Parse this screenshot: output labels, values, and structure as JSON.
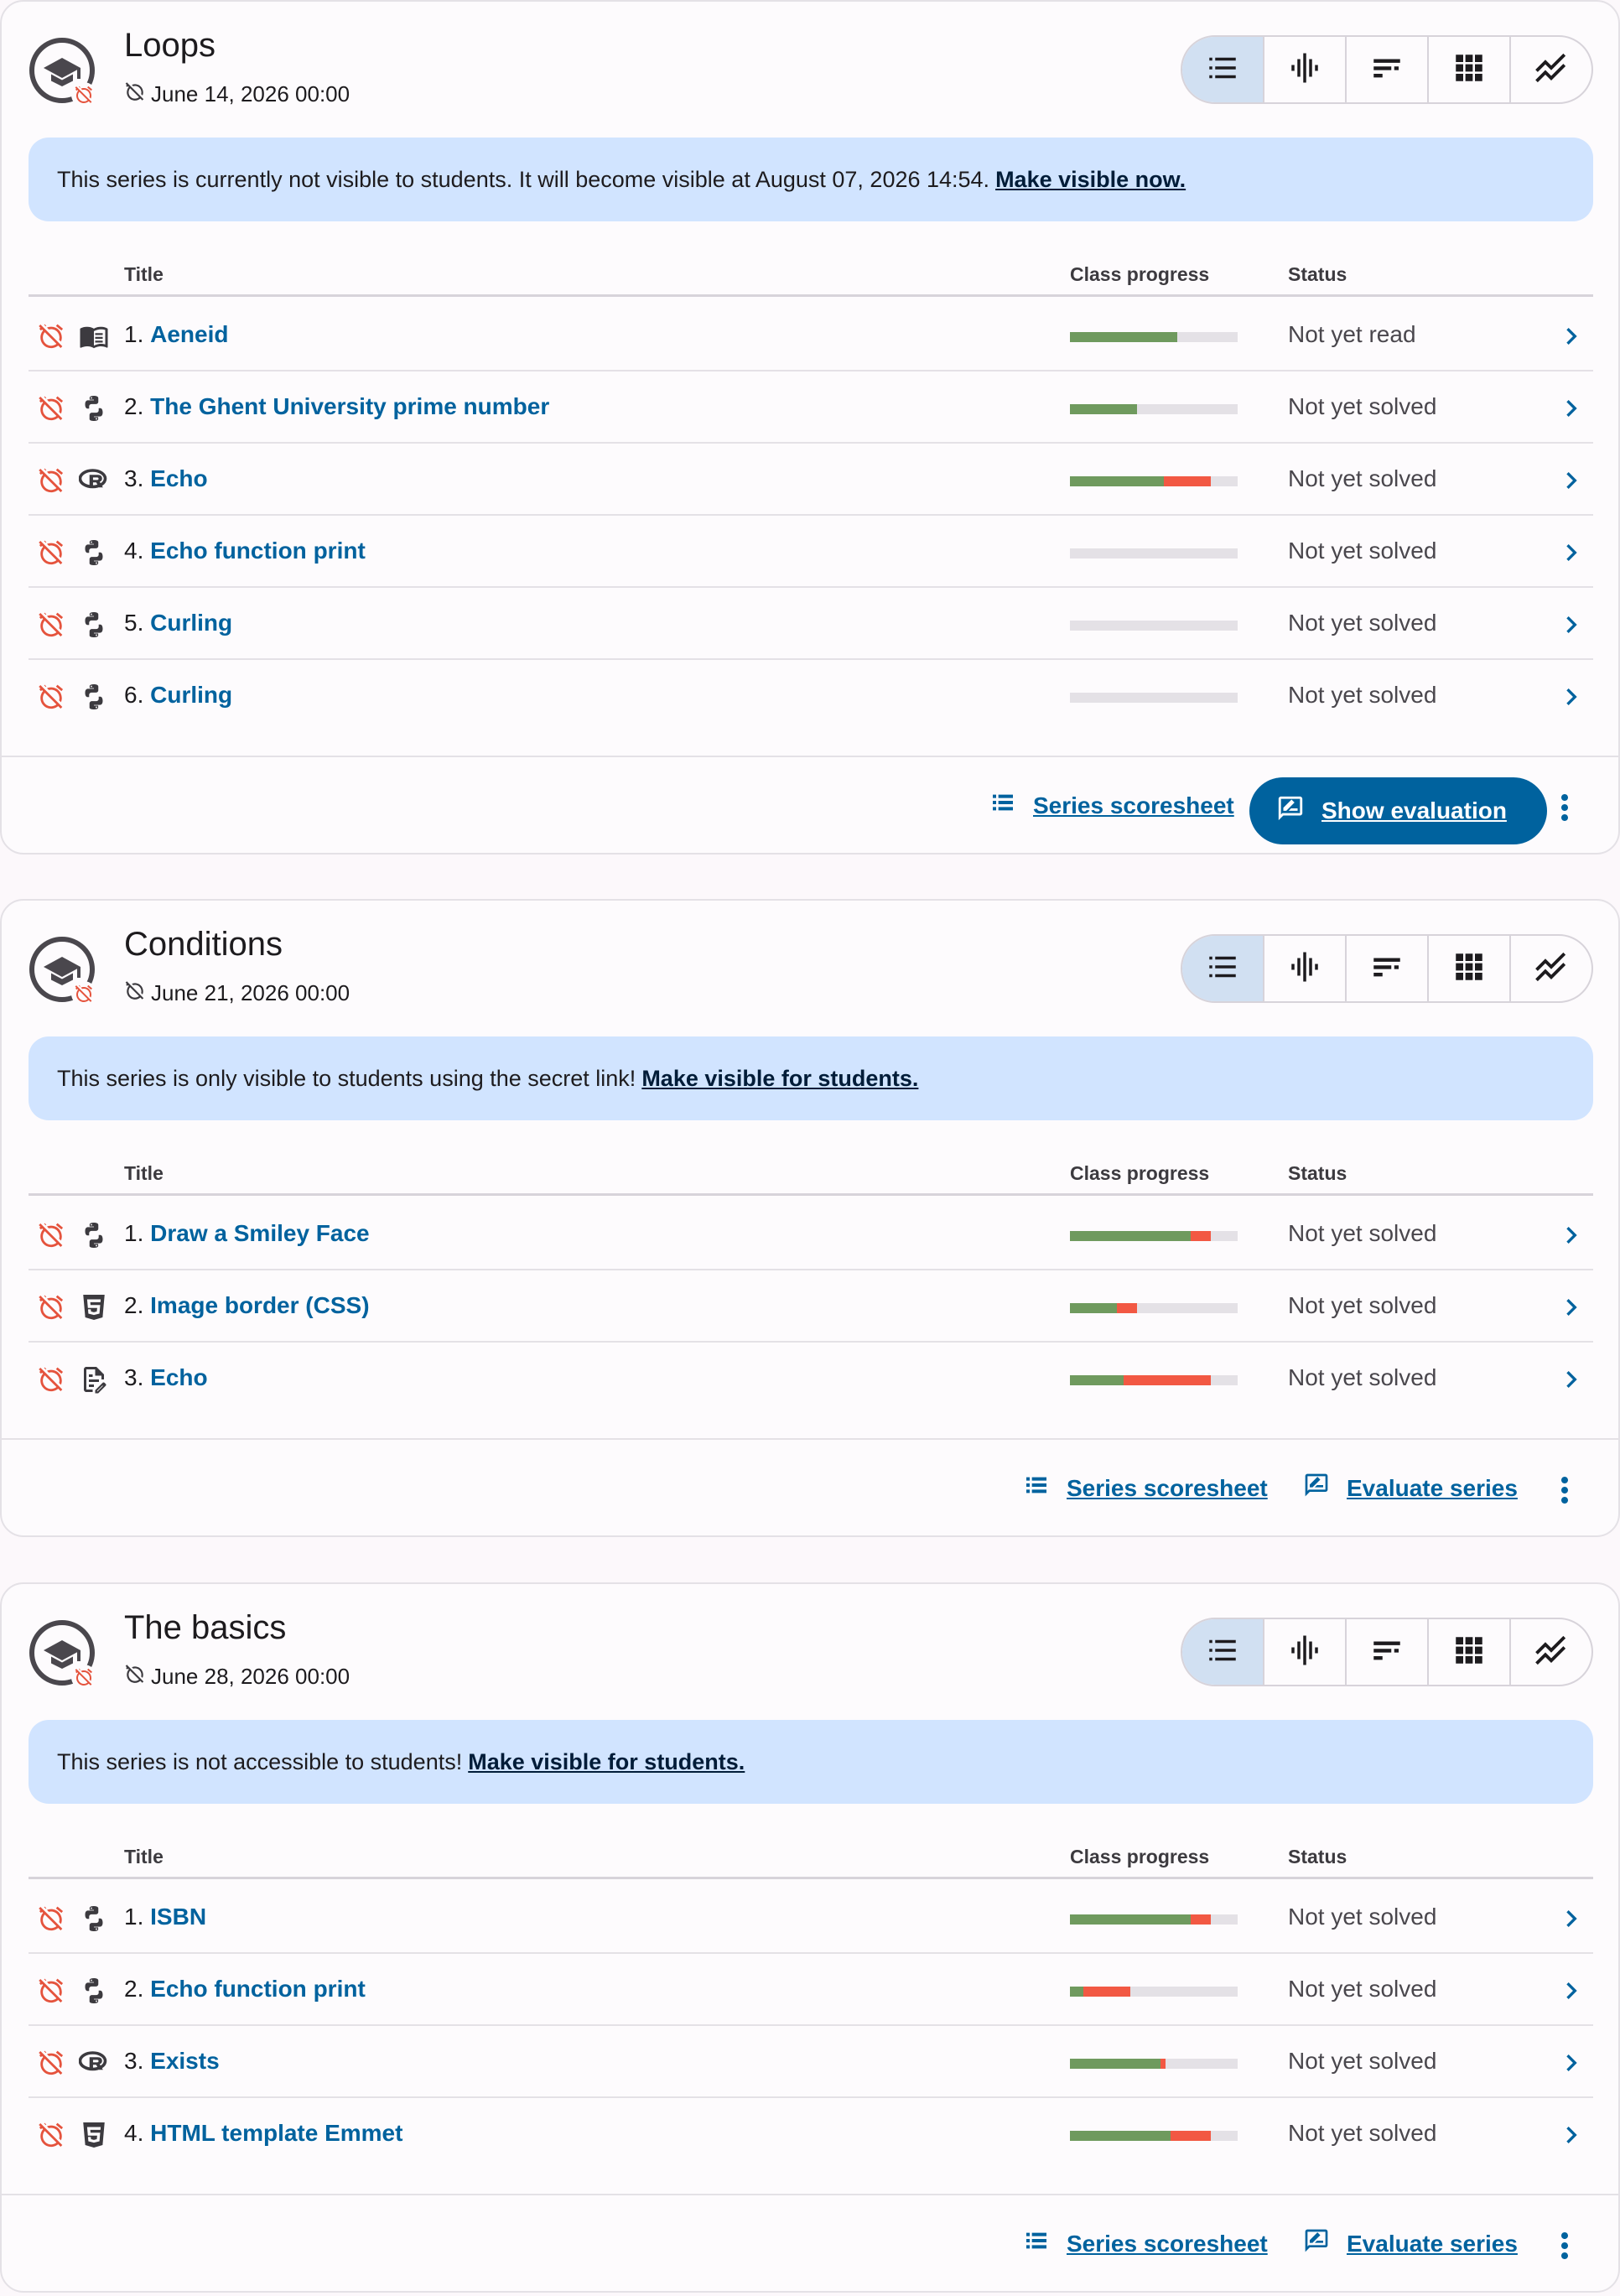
{
  "series": [
    {
      "title": "Loops",
      "deadline": "June 14, 2026 00:00",
      "notice_text": "This series is currently not visible to students. It will become visible at August 07, 2026 14:54.",
      "notice_link": "Make visible now.",
      "columns": {
        "title": "Title",
        "progress": "Class progress",
        "status": "Status"
      },
      "rows": [
        {
          "num": "1.",
          "name": "Aeneid",
          "type": "book-icon",
          "status": "Not yet read",
          "ok": 0.64,
          "bad": 0
        },
        {
          "num": "2.",
          "name": "The Ghent University prime number",
          "type": "python-icon",
          "status": "Not yet solved",
          "ok": 0.4,
          "bad": 0
        },
        {
          "num": "3.",
          "name": "Echo",
          "type": "r-icon",
          "status": "Not yet solved",
          "ok": 0.56,
          "bad": 0.28
        },
        {
          "num": "4.",
          "name": "Echo function print",
          "type": "python-icon",
          "status": "Not yet solved",
          "ok": 0,
          "bad": 0
        },
        {
          "num": "5.",
          "name": "Curling",
          "type": "python-icon",
          "status": "Not yet solved",
          "ok": 0,
          "bad": 0
        },
        {
          "num": "6.",
          "name": "Curling",
          "type": "python-icon",
          "status": "Not yet solved",
          "ok": 0,
          "bad": 0
        }
      ],
      "footer": {
        "scoresheet": "Series scoresheet",
        "evaluate": "Show evaluation",
        "evaluate_style": "filled"
      }
    },
    {
      "title": "Conditions",
      "deadline": "June 21, 2026 00:00",
      "notice_text": "This series is only visible to students using the secret link!",
      "notice_link": "Make visible for students.",
      "columns": {
        "title": "Title",
        "progress": "Class progress",
        "status": "Status"
      },
      "rows": [
        {
          "num": "1.",
          "name": "Draw a Smiley Face",
          "type": "python-icon",
          "status": "Not yet solved",
          "ok": 0.72,
          "bad": 0.12
        },
        {
          "num": "2.",
          "name": "Image border (CSS)",
          "type": "html-icon",
          "status": "Not yet solved",
          "ok": 0.28,
          "bad": 0.12
        },
        {
          "num": "3.",
          "name": "Echo",
          "type": "text-edit-icon",
          "status": "Not yet solved",
          "ok": 0.32,
          "bad": 0.52
        }
      ],
      "footer": {
        "scoresheet": "Series scoresheet",
        "evaluate": "Evaluate series",
        "evaluate_style": "text"
      }
    },
    {
      "title": "The basics",
      "deadline": "June 28, 2026 00:00",
      "notice_text": "This series is not accessible to students!",
      "notice_link": "Make visible for students.",
      "columns": {
        "title": "Title",
        "progress": "Class progress",
        "status": "Status"
      },
      "rows": [
        {
          "num": "1.",
          "name": "ISBN",
          "type": "python-icon",
          "status": "Not yet solved",
          "ok": 0.72,
          "bad": 0.12
        },
        {
          "num": "2.",
          "name": "Echo function print",
          "type": "python-icon",
          "status": "Not yet solved",
          "ok": 0.08,
          "bad": 0.28
        },
        {
          "num": "3.",
          "name": "Exists",
          "type": "r-icon",
          "status": "Not yet solved",
          "ok": 0.54,
          "bad": 0.03
        },
        {
          "num": "4.",
          "name": "HTML template Emmet",
          "type": "html-icon",
          "status": "Not yet solved",
          "ok": 0.6,
          "bad": 0.24
        }
      ],
      "footer": {
        "scoresheet": "Series scoresheet",
        "evaluate": "Evaluate series",
        "evaluate_style": "text"
      }
    }
  ],
  "colors": {
    "accent": "#00629e",
    "notice_bg": "#d1e4ff",
    "progress_ok": "#6f9a5e",
    "progress_bad": "#f25843",
    "alarm": "#e5533d"
  },
  "view_modes": [
    "list-icon",
    "graphic-eq-icon",
    "sort-bars-icon",
    "grid-icon",
    "trend-icon"
  ]
}
